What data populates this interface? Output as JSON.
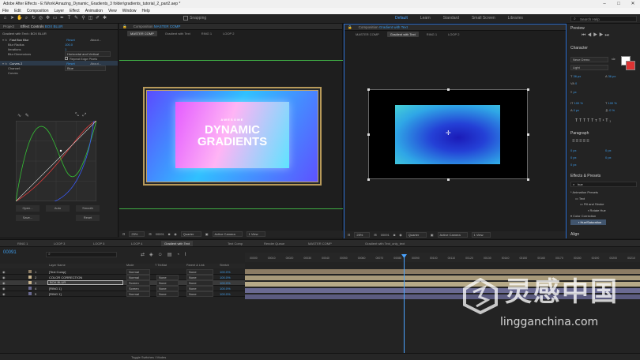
{
  "window": {
    "title": "Adobe After Effects - E:\\Work\\Amazing_Dynamic_Gradients_3 folder\\gradients_tutorial_2_part2.aep *"
  },
  "menu": [
    "File",
    "Edit",
    "Composition",
    "Layer",
    "Effect",
    "Animation",
    "View",
    "Window",
    "Help"
  ],
  "toolbar": {
    "snapping": "Snapping",
    "workspaces": [
      "Default",
      "Learn",
      "Standard",
      "Small Screen",
      "Libraries"
    ],
    "search_placeholder": "Search Help"
  },
  "effect_panel": {
    "tabs": {
      "project": "Project",
      "effect_controls": "Effect Controls",
      "effect_target": "BOX BLUR"
    },
    "layer_title": "Gradient with Text • BOX BLUR",
    "fast_box_blur": {
      "name": "Fast Box Blur",
      "reset": "Reset",
      "about": "About..."
    },
    "props": [
      {
        "name": "Blur Radius",
        "value": "100.0"
      },
      {
        "name": "Iterations",
        "value": "1"
      },
      {
        "name": "Blur Dimensions",
        "value": "Horizontal and Vertical"
      },
      {
        "name": "",
        "value": "Repeat Edge Pixels"
      }
    ],
    "curves": {
      "name": "Curves 2",
      "reset": "Reset",
      "about": "About...",
      "channel_label": "Channel:",
      "channel_value": "Blue",
      "curves_label": "Curves"
    },
    "curve_buttons": [
      "Open...",
      "Auto",
      "Smooth",
      "Save...",
      "Reset"
    ]
  },
  "comp_left": {
    "tab_label": "Composition",
    "tab_name": "MASTER COMP",
    "subtabs": [
      "MASTER COMP",
      "Gradient with Text",
      "RING 1",
      "LOOP 2"
    ],
    "active_subtab": 0,
    "art": {
      "kicker": "AWESOME",
      "title1": "DYNAMIC",
      "title2": "GRADIENTS"
    },
    "footer": {
      "zoom": "25%",
      "time": "00091",
      "quality": "Quarter",
      "camera": "Active Camera",
      "views": "1 View"
    }
  },
  "comp_right": {
    "tab_label": "Composition",
    "tab_name": "Gradient with Text",
    "subtabs": [
      "MASTER COMP",
      "Gradient with Text",
      "RING 1",
      "LOOP 2"
    ],
    "active_subtab": 1,
    "footer": {
      "zoom": "25%",
      "time": "00091",
      "quality": "Quarter",
      "camera": "Active Camera",
      "views": "1 View"
    }
  },
  "right_panel": {
    "preview": "Preview",
    "character": "Character",
    "font": "Neue Demo",
    "style": "Light",
    "size": "36 px",
    "leading": "36 px",
    "tracking": "0",
    "kern_unit": "px",
    "scale_v": "100 %",
    "scale_h": "100 %",
    "baseline": "0 px",
    "tsume": "0 %",
    "paragraph": "Paragraph",
    "para_values": [
      "0 px",
      "0 px",
      "0 px",
      "0 px",
      "0 px"
    ],
    "effects_presets": "Effects & Presets",
    "search": "hue",
    "tree": [
      "* Animation Presets",
      "Text",
      "Fill and Stroke",
      "Rotate Hue",
      "Color Correction",
      "Hue/Saturation"
    ],
    "align": "Align"
  },
  "timeline": {
    "tabs": [
      "RING 1",
      "LOOP 3",
      "LOOP 5",
      "LOOP 4",
      "Gradient with Text",
      "Text Comp",
      "Render Queue",
      "MASTER COMP",
      "Gradient with Text_only_text"
    ],
    "active_tab": 4,
    "time": "00091",
    "search_placeholder": "",
    "col_headers": {
      "layer_name": "Layer Name",
      "mode": "Mode",
      "trkmat": "T  TrkMat",
      "parent": "Parent & Link",
      "stretch": "Stretch"
    },
    "ruler": [
      "00000",
      "00010",
      "00020",
      "00030",
      "00040",
      "00050",
      "00060",
      "00070",
      "00080",
      "00090",
      "00100",
      "00110",
      "00120",
      "00130",
      "00140",
      "00150",
      "00160",
      "00170",
      "00180",
      "00190",
      "00200",
      "00210"
    ],
    "layers": [
      {
        "num": "1",
        "name": "[Text Comp]",
        "mode": "Normal",
        "trkmat": "",
        "parent": "None",
        "stretch": "100.0%"
      },
      {
        "num": "2",
        "name": "COLOR CORRECTION",
        "mode": "Normal",
        "trkmat": "None",
        "parent": "None",
        "stretch": "100.0%"
      },
      {
        "num": "3",
        "name": "BOX BLUR",
        "mode": "Screen",
        "trkmat": "None",
        "parent": "None",
        "stretch": "100.0%"
      },
      {
        "num": "4",
        "name": "[RING 1]",
        "mode": "Screen",
        "trkmat": "None",
        "parent": "None",
        "stretch": "100.0%"
      },
      {
        "num": "5",
        "name": "[RING 1]",
        "mode": "Normal",
        "trkmat": "None",
        "parent": "None",
        "stretch": "100.0%"
      }
    ],
    "footer": "Toggle Switches / Modes"
  },
  "watermark": {
    "cn": "灵感中国",
    "url": "lingganchina.com"
  },
  "colors": {
    "accent_blue": "#2d8ceb",
    "layer_tan": "#8c7c64",
    "layer_purple": "#6a6a92",
    "playhead": "#4aa3ff"
  }
}
